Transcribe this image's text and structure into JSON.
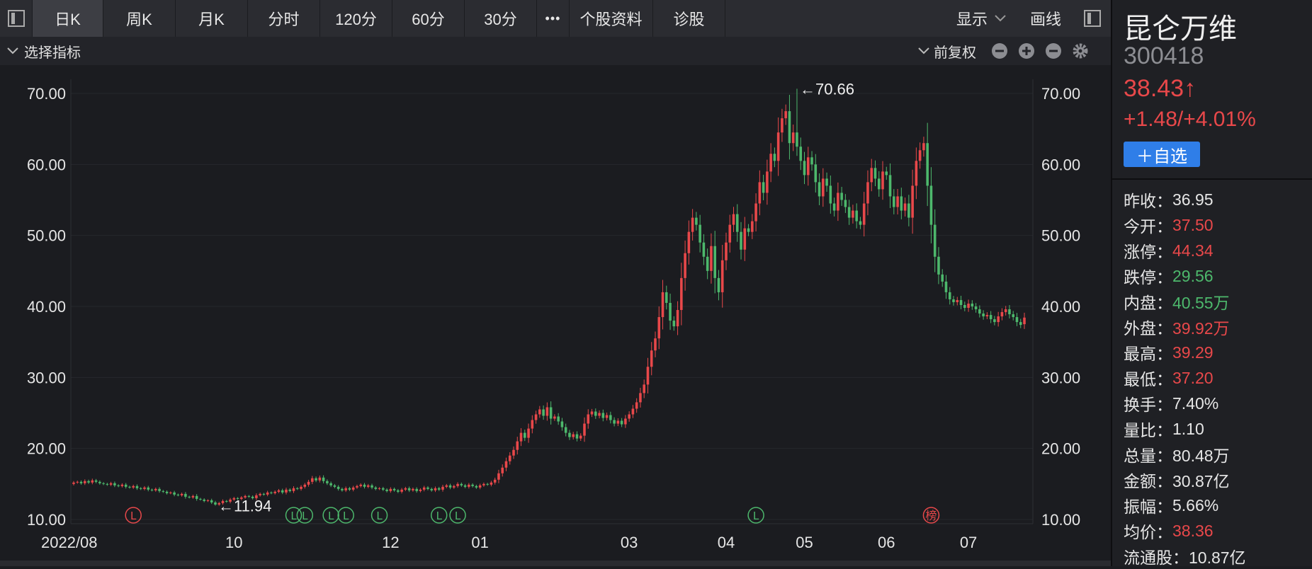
{
  "toolbar": {
    "tabs": [
      "日K",
      "周K",
      "月K",
      "分时",
      "120分",
      "60分",
      "30分"
    ],
    "more": "•••",
    "profile": "个股资料",
    "diagnose": "诊股",
    "display": "显示",
    "draw": "画线"
  },
  "subbar": {
    "indicator": "选择指标",
    "adjust": "前复权"
  },
  "colors": {
    "up": "#e8484a",
    "down": "#4db86c",
    "bg": "#1b1c20",
    "accent": "#2f7ee8"
  },
  "panel": {
    "name": "昆仑万维",
    "code": "300418",
    "price": "38.43↑",
    "change": "+1.48/+4.01%",
    "fav": "＋自选",
    "stats": [
      {
        "label": "昨收：",
        "value": "36.95",
        "tone": "neu"
      },
      {
        "label": "今开：",
        "value": "37.50",
        "tone": "up"
      },
      {
        "label": "涨停：",
        "value": "44.34",
        "tone": "up"
      },
      {
        "label": "跌停：",
        "value": "29.56",
        "tone": "down"
      },
      {
        "label": "内盘：",
        "value": "40.55万",
        "tone": "down"
      },
      {
        "label": "外盘：",
        "value": "39.92万",
        "tone": "up"
      },
      {
        "label": "最高：",
        "value": "39.29",
        "tone": "up"
      },
      {
        "label": "最低：",
        "value": "37.20",
        "tone": "up"
      },
      {
        "label": "换手：",
        "value": "7.40%",
        "tone": "neu"
      },
      {
        "label": "量比：",
        "value": "1.10",
        "tone": "neu"
      },
      {
        "label": "总量：",
        "value": "80.48万",
        "tone": "neu"
      },
      {
        "label": "金额：",
        "value": "30.87亿",
        "tone": "neu"
      },
      {
        "label": "振幅：",
        "value": "5.66%",
        "tone": "neu"
      },
      {
        "label": "均价：",
        "value": "38.36",
        "tone": "up"
      },
      {
        "label": "流通股：",
        "value": "10.87亿",
        "tone": "neu"
      }
    ]
  },
  "chart_data": {
    "type": "candlestick",
    "ylim": [
      10,
      72
    ],
    "yticks": [
      "10.00",
      "20.00",
      "30.00",
      "40.00",
      "50.00",
      "60.00",
      "70.00"
    ],
    "xticks": [
      "2022/08",
      "10",
      "12",
      "01",
      "03",
      "04",
      "05",
      "06",
      "07"
    ],
    "xtick_day_index": [
      0,
      43,
      85,
      109,
      149,
      175,
      196,
      218,
      240
    ],
    "annotations": [
      {
        "text": "←70.66",
        "day": 194,
        "value": 70.66
      },
      {
        "text": "←11.94",
        "day": 38,
        "value": 11.94
      }
    ],
    "event_markers": [
      {
        "symbol": "L",
        "day": 16,
        "tone": "up"
      },
      {
        "symbol": "L",
        "day": 59,
        "tone": "down"
      },
      {
        "symbol": "L",
        "day": 62,
        "tone": "down"
      },
      {
        "symbol": "L",
        "day": 69,
        "tone": "down"
      },
      {
        "symbol": "L",
        "day": 73,
        "tone": "down"
      },
      {
        "symbol": "L",
        "day": 82,
        "tone": "down"
      },
      {
        "symbol": "L",
        "day": 98,
        "tone": "down"
      },
      {
        "symbol": "L",
        "day": 103,
        "tone": "down"
      },
      {
        "symbol": "L",
        "day": 183,
        "tone": "down"
      },
      {
        "symbol": "榜",
        "day": 230,
        "tone": "up"
      }
    ],
    "closes": [
      15.2,
      15.3,
      15.1,
      15.4,
      15.2,
      15.5,
      15.3,
      15.1,
      15.0,
      14.9,
      15.1,
      14.8,
      14.7,
      14.9,
      14.6,
      14.5,
      14.7,
      14.4,
      14.3,
      14.5,
      14.2,
      14.1,
      14.3,
      14.0,
      13.9,
      13.7,
      13.8,
      13.5,
      13.4,
      13.6,
      13.2,
      13.1,
      13.3,
      12.9,
      12.8,
      12.6,
      12.7,
      12.4,
      12.1,
      12.3,
      12.6,
      12.5,
      12.8,
      13.0,
      12.9,
      13.1,
      13.3,
      13.2,
      13.0,
      13.4,
      13.6,
      13.5,
      13.8,
      13.7,
      13.9,
      14.1,
      13.8,
      14.2,
      14.0,
      14.4,
      14.3,
      14.6,
      14.9,
      15.3,
      15.8,
      15.5,
      15.9,
      15.4,
      15.1,
      14.8,
      14.6,
      14.3,
      14.1,
      14.4,
      14.2,
      14.5,
      14.7,
      14.9,
      14.6,
      14.8,
      14.5,
      14.3,
      14.4,
      14.2,
      14.0,
      14.3,
      14.1,
      13.9,
      14.2,
      14.4,
      14.1,
      14.3,
      14.0,
      14.2,
      14.5,
      14.3,
      14.1,
      14.4,
      14.2,
      14.6,
      14.8,
      14.5,
      14.7,
      15.0,
      14.8,
      14.6,
      14.9,
      14.7,
      14.5,
      14.8,
      15.0,
      14.9,
      15.2,
      15.6,
      16.5,
      17.3,
      18.2,
      19.0,
      19.8,
      21.0,
      22.2,
      21.5,
      22.8,
      24.0,
      24.8,
      25.5,
      24.6,
      25.8,
      24.2,
      24.5,
      23.8,
      23.0,
      22.2,
      21.6,
      22.0,
      21.4,
      21.8,
      23.5,
      24.8,
      25.2,
      24.6,
      25.0,
      24.3,
      24.7,
      24.0,
      23.5,
      23.9,
      23.4,
      24.2,
      24.8,
      25.6,
      26.5,
      27.8,
      29.0,
      31.5,
      33.8,
      35.5,
      38.5,
      42.0,
      40.5,
      38.0,
      37.2,
      39.5,
      44.0,
      47.5,
      50.5,
      52.5,
      51.5,
      49.0,
      47.0,
      45.0,
      48.5,
      44.0,
      42.0,
      46.5,
      49.0,
      51.5,
      53.0,
      50.5,
      48.0,
      51.0,
      50.5,
      52.0,
      54.5,
      57.5,
      56.0,
      59.0,
      61.5,
      60.5,
      64.5,
      66.5,
      67.5,
      63.0,
      64.5,
      62.5,
      60.5,
      58.5,
      61.0,
      60.0,
      57.5,
      55.5,
      58.0,
      57.0,
      54.5,
      53.5,
      56.0,
      55.0,
      54.0,
      52.5,
      53.5,
      52.0,
      51.5,
      54.5,
      57.5,
      59.5,
      58.0,
      56.5,
      59.0,
      58.5,
      55.5,
      54.0,
      55.5,
      53.5,
      54.5,
      52.5,
      57.0,
      60.5,
      62.0,
      63.0,
      57.0,
      51.5,
      47.0,
      44.5,
      43.5,
      42.0,
      41.0,
      40.6,
      40.9,
      40.2,
      39.8,
      40.4,
      40.0,
      39.6,
      39.0,
      38.6,
      38.8,
      38.2,
      37.8,
      38.6,
      39.2,
      39.6,
      38.9,
      38.5,
      37.8,
      37.4,
      38.43
    ],
    "last_open": 37.5
  }
}
